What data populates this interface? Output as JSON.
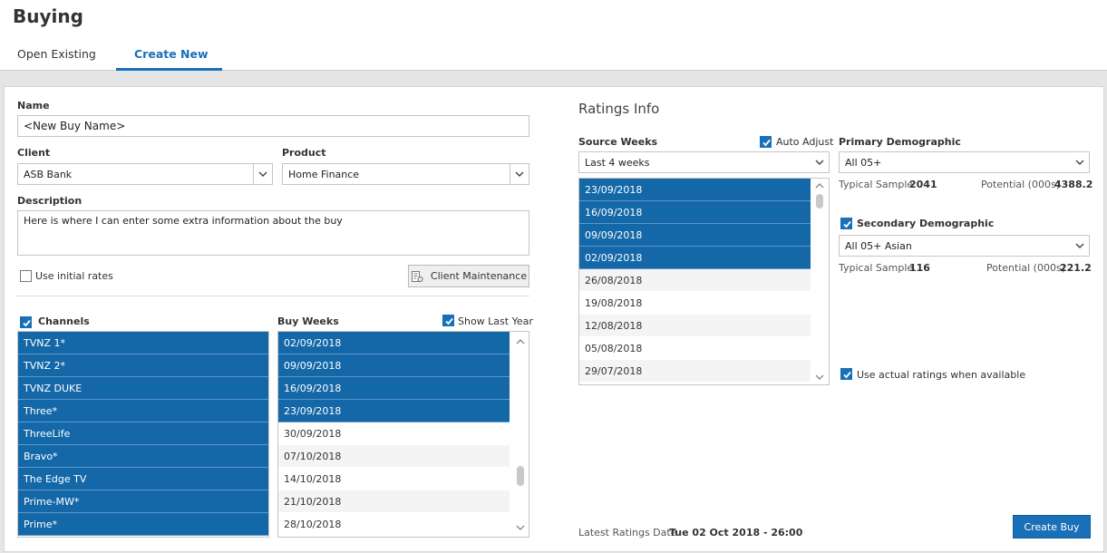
{
  "page": {
    "title": "Buying"
  },
  "tabs": [
    {
      "label": "Open Existing",
      "active": false
    },
    {
      "label": "Create New",
      "active": true
    }
  ],
  "form": {
    "name_label": "Name",
    "name_value": "<New Buy Name>",
    "client_label": "Client",
    "client_value": "ASB Bank",
    "product_label": "Product",
    "product_value": "Home Finance",
    "description_label": "Description",
    "description_value": "Here is where I can enter some extra information about the buy",
    "use_initial_rates_label": "Use initial rates",
    "client_maintenance_label": "Client Maintenance"
  },
  "channels": {
    "label": "Channels",
    "items": [
      {
        "label": "TVNZ 1*",
        "selected": true
      },
      {
        "label": "TVNZ 2*",
        "selected": true
      },
      {
        "label": "TVNZ DUKE",
        "selected": true
      },
      {
        "label": "Three*",
        "selected": true
      },
      {
        "label": "ThreeLife",
        "selected": true
      },
      {
        "label": "Bravo*",
        "selected": true
      },
      {
        "label": "The Edge TV",
        "selected": true
      },
      {
        "label": "Prime-MW*",
        "selected": true
      },
      {
        "label": "Prime*",
        "selected": true
      }
    ]
  },
  "buy_weeks": {
    "label": "Buy Weeks",
    "show_last_year_label": "Show Last Year",
    "items": [
      {
        "label": "02/09/2018",
        "selected": true
      },
      {
        "label": "09/09/2018",
        "selected": true
      },
      {
        "label": "16/09/2018",
        "selected": true
      },
      {
        "label": "23/09/2018",
        "selected": true
      },
      {
        "label": "30/09/2018",
        "selected": false
      },
      {
        "label": "07/10/2018",
        "selected": false
      },
      {
        "label": "14/10/2018",
        "selected": false
      },
      {
        "label": "21/10/2018",
        "selected": false
      },
      {
        "label": "28/10/2018",
        "selected": false
      }
    ]
  },
  "ratings": {
    "title": "Ratings Info",
    "source_weeks_label": "Source Weeks",
    "auto_adjust_label": "Auto Adjust",
    "source_weeks_value": "Last 4 weeks",
    "source_weeks": [
      {
        "label": "23/09/2018",
        "selected": true
      },
      {
        "label": "16/09/2018",
        "selected": true
      },
      {
        "label": "09/09/2018",
        "selected": true
      },
      {
        "label": "02/09/2018",
        "selected": true
      },
      {
        "label": "26/08/2018",
        "selected": false
      },
      {
        "label": "19/08/2018",
        "selected": false
      },
      {
        "label": "12/08/2018",
        "selected": false
      },
      {
        "label": "05/08/2018",
        "selected": false
      },
      {
        "label": "29/07/2018",
        "selected": false
      }
    ],
    "primary_label": "Primary Demographic",
    "primary_value": "All 05+",
    "typical_sample_label": "Typical Sample",
    "primary_typical_sample": "2041",
    "potential_label": "Potential (000s)",
    "primary_potential": "4388.2",
    "secondary_label": "Secondary Demographic",
    "secondary_value": "All 05+ Asian",
    "secondary_typical_sample": "116",
    "secondary_potential": "221.2",
    "use_actual_label": "Use actual ratings when available",
    "latest_date_label": "Latest Ratings Date",
    "latest_date_value": "Tue 02 Oct 2018 - 26:00",
    "create_buy_label": "Create Buy"
  },
  "colors": {
    "accent": "#1a70b8",
    "selection": "#1468a8"
  }
}
